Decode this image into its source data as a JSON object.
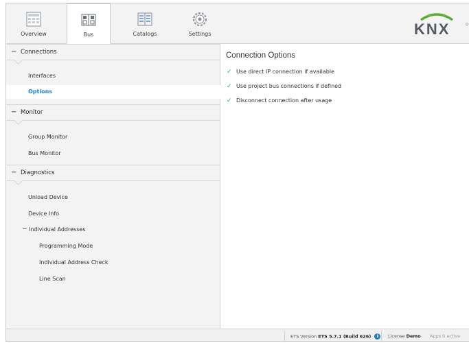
{
  "ribbon": {
    "tabs": [
      {
        "label": "Overview",
        "icon": "overview-icon"
      },
      {
        "label": "Bus",
        "icon": "bus-icon"
      },
      {
        "label": "Catalogs",
        "icon": "catalogs-icon"
      },
      {
        "label": "Settings",
        "icon": "settings-gear-icon"
      }
    ],
    "active_tab": "Bus",
    "logo_text": "KNX"
  },
  "sidebar": {
    "connections": {
      "header": "Connections",
      "items": [
        "Interfaces",
        "Options"
      ],
      "selected": "Options"
    },
    "monitor": {
      "header": "Monitor",
      "items": [
        "Group Monitor",
        "Bus Monitor"
      ]
    },
    "diagnostics": {
      "header": "Diagnostics",
      "items": [
        "Unload Device",
        "Device Info"
      ],
      "individual_addresses": {
        "header": "Individual Addresses",
        "items": [
          "Programming Mode",
          "Individual Address Check",
          "Line Scan"
        ]
      }
    },
    "collapse_symbol": "−"
  },
  "main": {
    "title": "Connection Options",
    "options": [
      {
        "label": "Use direct IP connection if available",
        "checked": true
      },
      {
        "label": "Use project bus connections if defined",
        "checked": true
      },
      {
        "label": "Disconnect connection after usage",
        "checked": true
      }
    ],
    "check_glyph": "✓"
  },
  "status_bar": {
    "ets_version_label": "ETS Version",
    "ets_version_value": "ETS 5.7.1 (Build 626)",
    "license_label": "License",
    "license_value": "Demo",
    "apps_label": "Apps",
    "apps_value": "0 active"
  },
  "colors": {
    "accent_blue": "#1e7fc5",
    "check_green": "#3aa35e",
    "knx_green": "#5aae31"
  }
}
